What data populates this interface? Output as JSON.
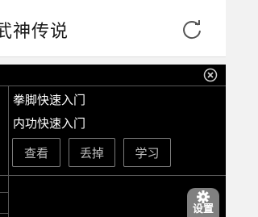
{
  "header": {
    "title": "武神传说",
    "reload_icon": "reload-icon"
  },
  "panel": {
    "close_icon": "close-circle-icon",
    "skills": [
      {
        "label": "拳脚快速入门"
      },
      {
        "label": "内功快速入门"
      }
    ],
    "actions": [
      {
        "label": "查看"
      },
      {
        "label": "丢掉"
      },
      {
        "label": "学习"
      }
    ]
  },
  "settings": {
    "label": "设置",
    "icon": "gear-icon"
  }
}
